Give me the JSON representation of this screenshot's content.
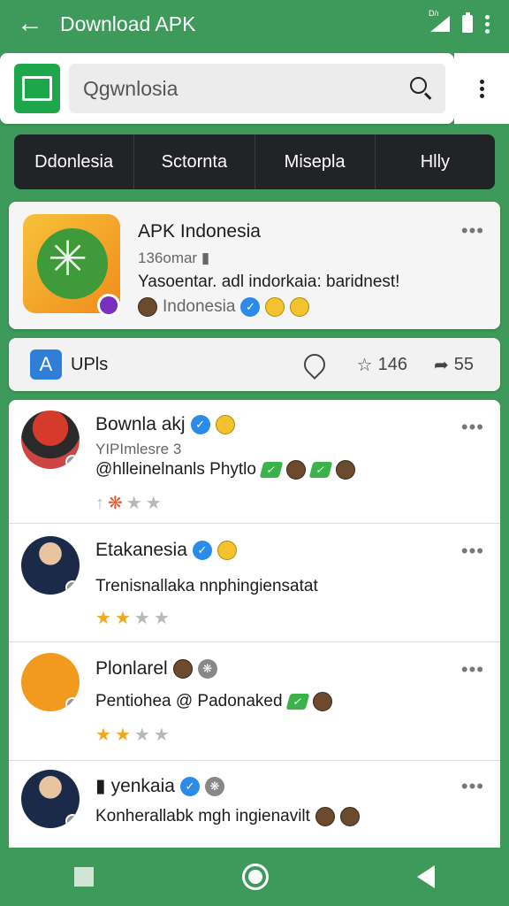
{
  "appbar": {
    "title": "Download APK",
    "signal_text": "D/ı"
  },
  "search": {
    "value": "Qgwnlosia"
  },
  "tabs": [
    "Ddonlesia",
    "Sctornta",
    "Misepla",
    "Hlly"
  ],
  "featured": {
    "title": "APK Indonesia",
    "size": "136omar",
    "description": "Yasoentar. adl indorkaia: baridnest!",
    "region": "Indonesia"
  },
  "actionbar": {
    "label": "UPls",
    "stars": "146",
    "shares": "55"
  },
  "posts": [
    {
      "name": "Bownla akj",
      "subtitle": "YIPImlesre 3",
      "text": "@hlleinelnanls Phytlo",
      "rating": 0
    },
    {
      "name": "Etakanesia",
      "text": "Trenisnallaka nnphingiensatat",
      "rating": 2
    },
    {
      "name": "Plonlarel",
      "text": "Pentiohea @ Padonaked",
      "rating": 2
    },
    {
      "name": "yenkaia",
      "text": "Konherallabk mgh ingienavilt",
      "rating": 0
    }
  ],
  "colors": {
    "brand": "#3e9a5a",
    "tabs_bg": "#222326",
    "star": "#f2a81c",
    "verify": "#2a8be8"
  }
}
